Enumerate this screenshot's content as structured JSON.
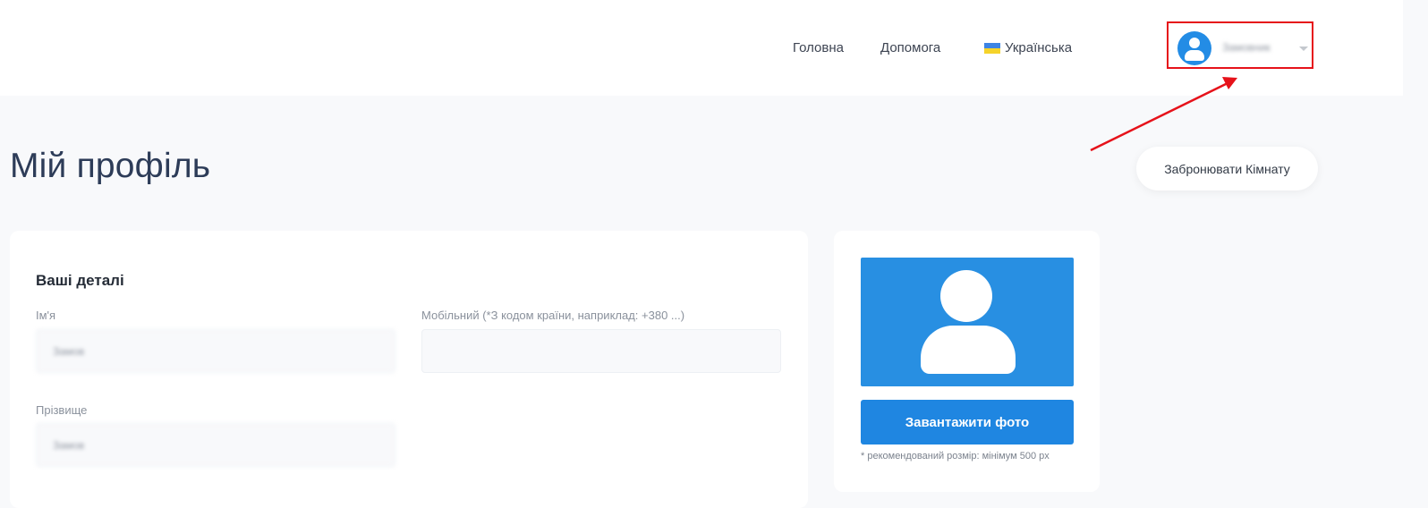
{
  "header": {
    "nav": {
      "home": "Головна",
      "help": "Допомога",
      "language": "Українська"
    },
    "user_menu": {
      "name": "Замовник"
    }
  },
  "page": {
    "title": "Мій профіль",
    "book_room_button": "Забронювати Кімнату"
  },
  "details": {
    "section_title": "Ваші деталі",
    "first_name": {
      "label": "Ім'я",
      "value": "Замов"
    },
    "mobile": {
      "label": "Мобільний (*З кодом країни, наприклад: +380 ...)",
      "value": ""
    },
    "last_name": {
      "label": "Прізвище",
      "value": "Замов"
    }
  },
  "photo": {
    "upload_button": "Завантажити фото",
    "hint": "* рекомендований розмір: мінімум 500 px"
  },
  "colors": {
    "accent": "#1f86e1",
    "annotation": "#e6121a"
  }
}
